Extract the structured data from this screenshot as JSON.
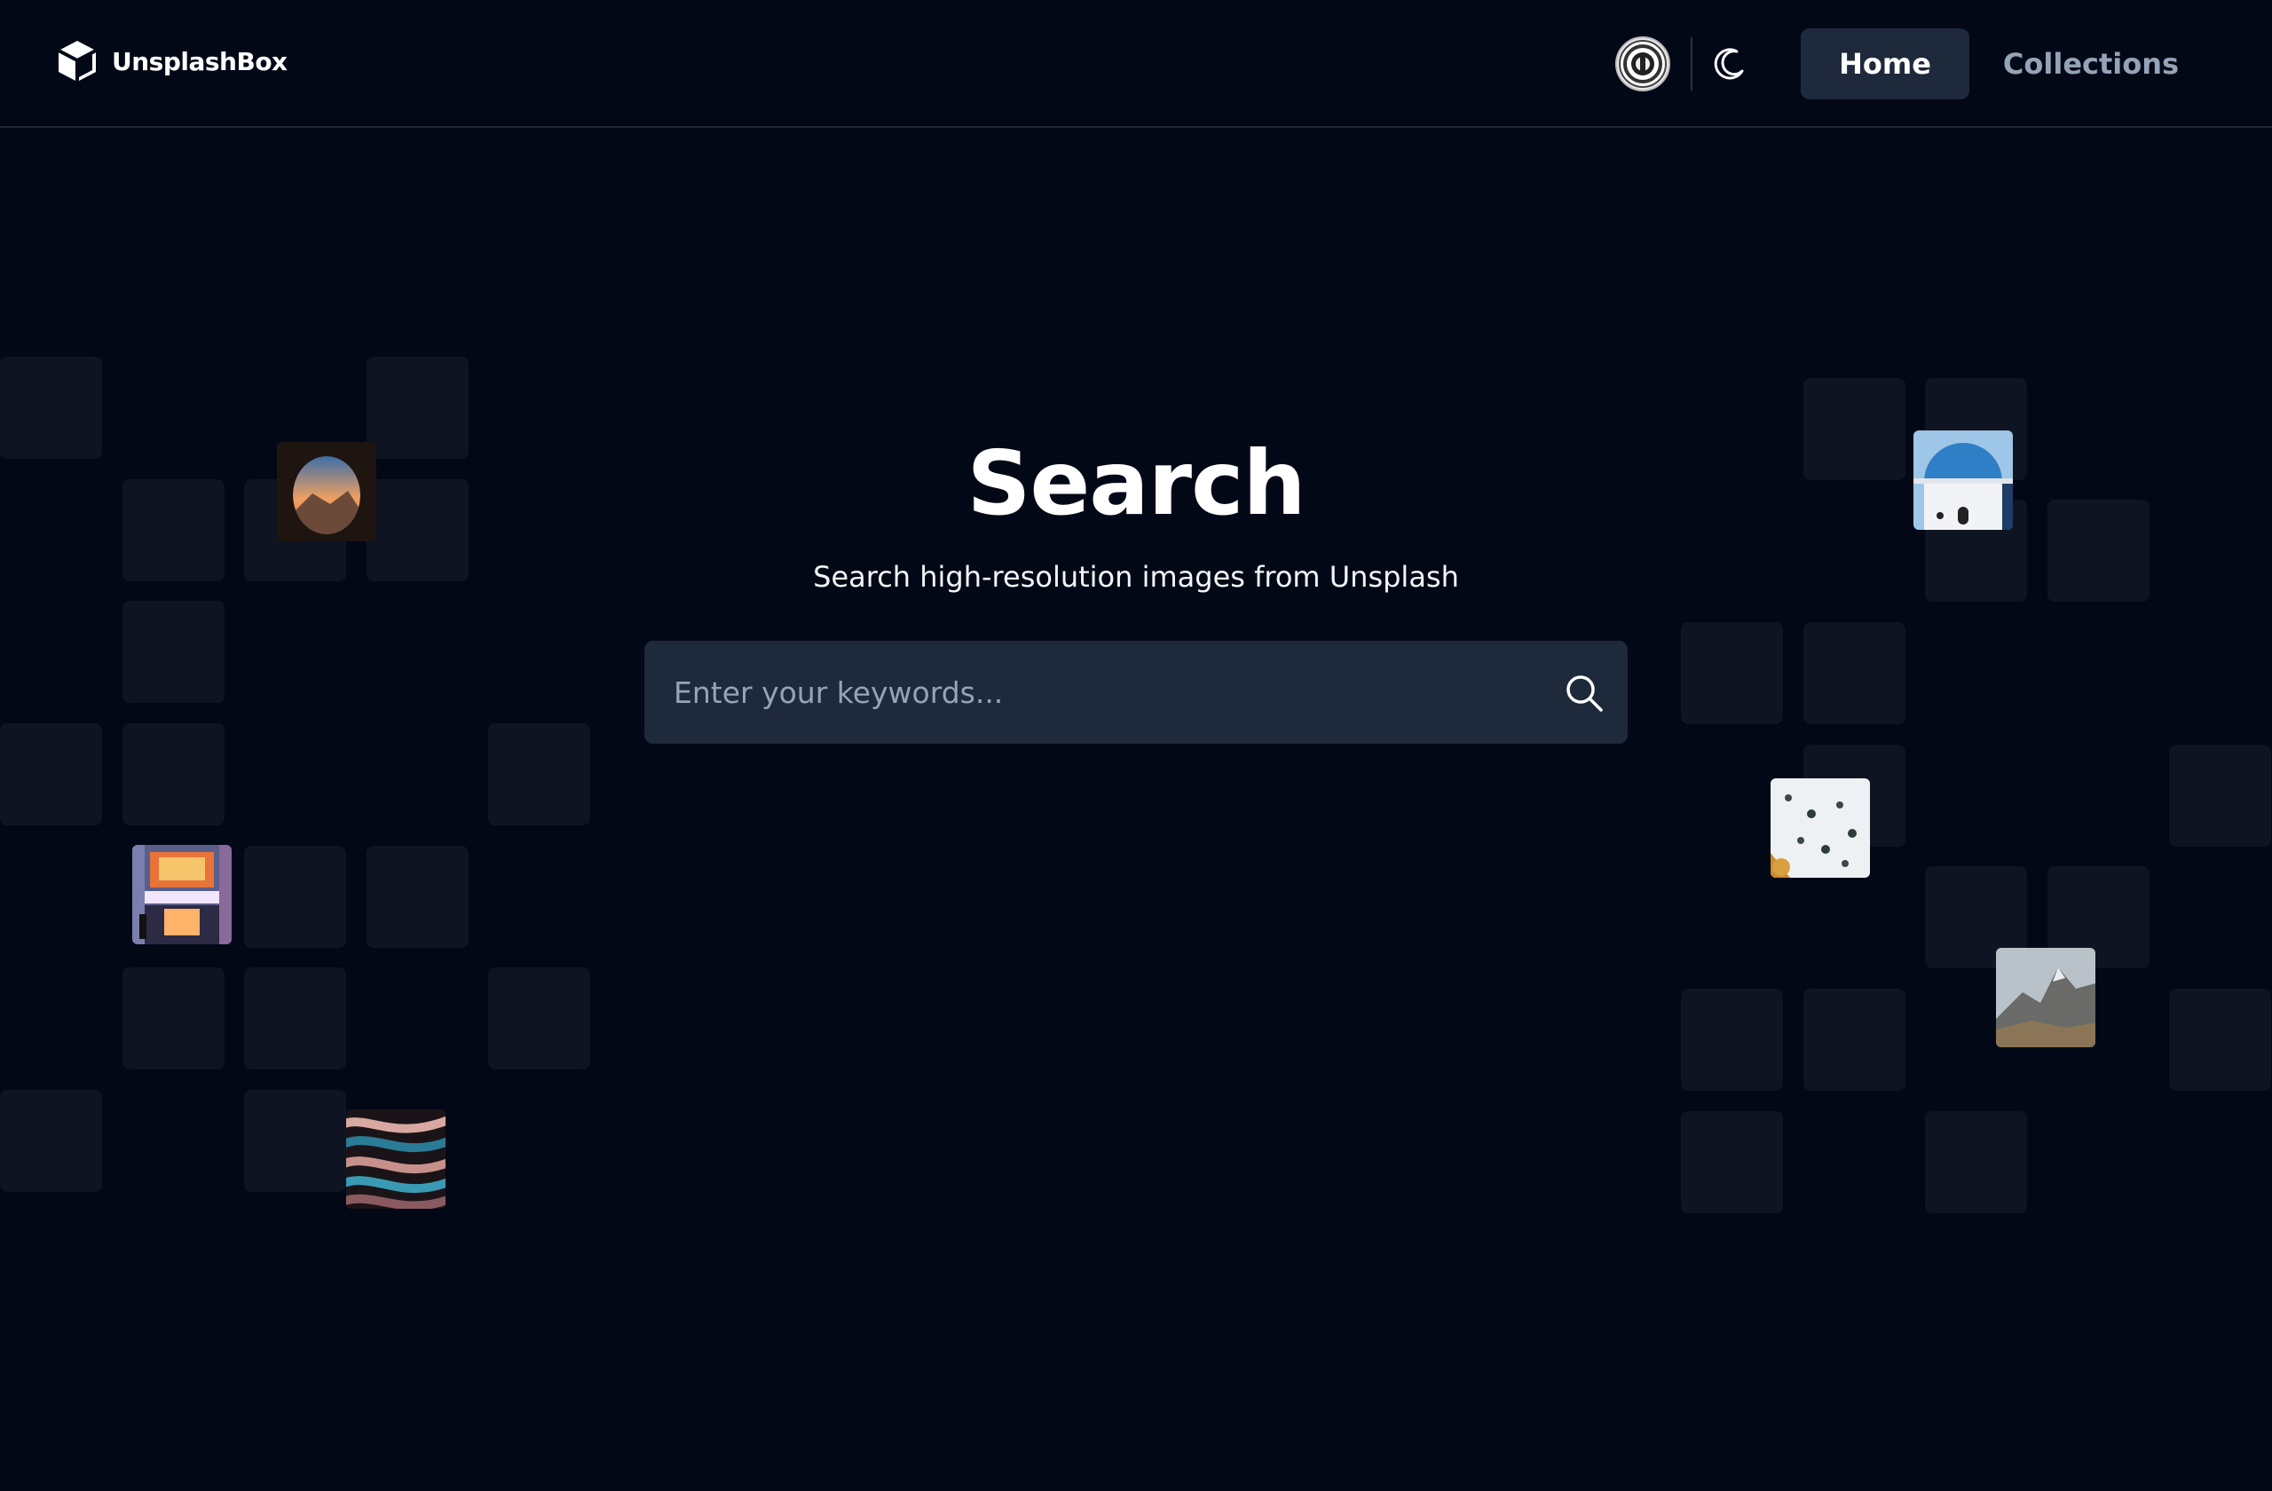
{
  "header": {
    "brand_name": "UnsplashBox",
    "brand_icon": "cube-icon",
    "avatar_icon": "user-avatar",
    "theme_toggle_icon": "moon-icon",
    "nav": {
      "home_label": "Home",
      "collections_label": "Collections"
    }
  },
  "hero": {
    "title": "Search",
    "subtitle": "Search high-resolution images from Unsplash"
  },
  "search": {
    "placeholder": "Enter your keywords...",
    "value": "",
    "icon": "search-icon"
  },
  "decor": {
    "photos": [
      "cave-sunset-photo",
      "santorini-dome-photo",
      "snowy-forest-photo",
      "neon-storefront-photo",
      "mountain-peak-photo",
      "abstract-waves-photo"
    ]
  },
  "colors": {
    "background": "#030817",
    "surface": "#1e293b",
    "tile": "#0e1421",
    "muted_text": "#94a3b8"
  }
}
